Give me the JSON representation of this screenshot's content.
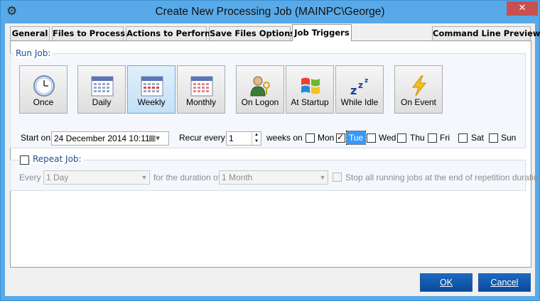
{
  "window": {
    "title": "Create New Processing Job (MAINPC\\George)",
    "close_label": "✕",
    "icon": "gear-icon"
  },
  "tabs": [
    {
      "label": "General"
    },
    {
      "label": "Files to Process"
    },
    {
      "label": "Actions to Perform"
    },
    {
      "label": "Save Files Options"
    },
    {
      "label": "Job Triggers",
      "active": true
    },
    {
      "label": "Command Line Preview"
    }
  ],
  "run_job": {
    "label": "Run Job:",
    "buttons": [
      {
        "label": "Once",
        "icon": "clock-icon"
      },
      {
        "label": "Daily",
        "icon": "calendar-daily-icon"
      },
      {
        "label": "Weekly",
        "icon": "calendar-weekly-icon",
        "selected": true
      },
      {
        "label": "Monthly",
        "icon": "calendar-monthly-icon"
      },
      {
        "label": "On Logon",
        "icon": "user-key-icon"
      },
      {
        "label": "At Startup",
        "icon": "windows-logo-icon"
      },
      {
        "label": "While Idle",
        "icon": "sleep-zzz-icon"
      },
      {
        "label": "On Event",
        "icon": "lightning-icon"
      }
    ],
    "start_on_label": "Start on:",
    "start_on_value": "24 December 2014 10:11",
    "recur_label": "Recur every:",
    "recur_value": "1",
    "weeks_on_label": "weeks on",
    "days": [
      {
        "label": "Mon",
        "checked": false
      },
      {
        "label": "Tue",
        "checked": true
      },
      {
        "label": "Wed",
        "checked": false
      },
      {
        "label": "Thu",
        "checked": false
      },
      {
        "label": "Fri",
        "checked": false
      },
      {
        "label": "Sat",
        "checked": false
      },
      {
        "label": "Sun",
        "checked": false
      }
    ]
  },
  "repeat_job": {
    "label": "Repeat Job:",
    "checked": false,
    "every_label": "Every",
    "every_value": "1 Day",
    "duration_label": "for the duration of:",
    "duration_value": "1 Month",
    "stop_label": "Stop all running jobs at the end of repetition duration"
  },
  "footer": {
    "ok_label": "OK",
    "cancel_label": "Cancel"
  },
  "colors": {
    "frame": "#58a9e8",
    "accent": "#0a4a98",
    "group_label": "#1f4f8f"
  }
}
